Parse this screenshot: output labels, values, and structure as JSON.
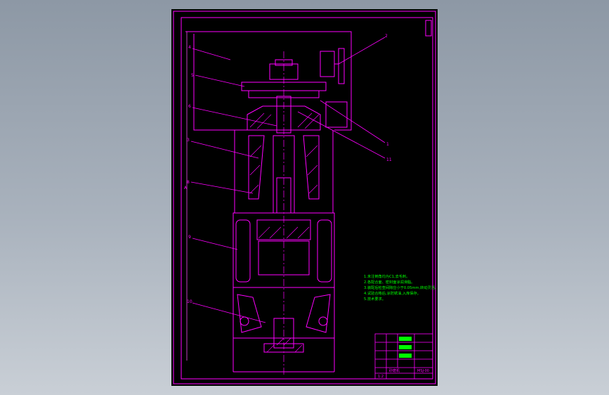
{
  "drawing": {
    "colors": {
      "background": "#000000",
      "line": "#ff00ff",
      "notes": "#00ff00",
      "dim": "#c040c0",
      "viewer_bg": "#9ba5b1"
    },
    "balloons": [
      "2",
      "4",
      "5",
      "6",
      "3",
      "8",
      "9",
      "10",
      "1",
      "11"
    ],
    "left_marker": "A",
    "tech_notes": [
      "1.未注倒角均为C1,去毛刺。",
      "2.各配合面、密封面涂润滑脂。",
      "3.装配后检查间隙应小于0.05mm,转动灵活。",
      "4.试验合格后,涂防锈油,入库保存。",
      "5.技术要求。"
    ],
    "title_block": {
      "name": "砂磨机",
      "drawing_no": "MSJ-00",
      "scale": "1:2"
    }
  }
}
